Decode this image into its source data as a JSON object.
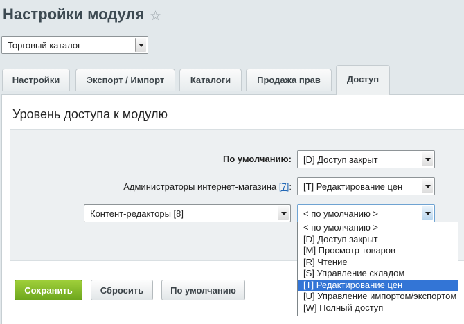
{
  "page": {
    "title": "Настройки модуля"
  },
  "module_select": {
    "value": "Торговый каталог"
  },
  "tabs": [
    {
      "label": "Настройки"
    },
    {
      "label": "Экспорт / Импорт"
    },
    {
      "label": "Каталоги"
    },
    {
      "label": "Продажа прав"
    },
    {
      "label": "Доступ"
    }
  ],
  "section": {
    "title": "Уровень доступа к модулю"
  },
  "rows": {
    "default": {
      "label": "По умолчанию:",
      "value": "[D] Доступ закрыт"
    },
    "admins": {
      "label": "Администраторы интернет-магазина ",
      "link": "[7]",
      "suffix": ":",
      "value": "[T] Редактирование цен"
    },
    "group": {
      "value": "Контент-редакторы [8]",
      "access_value": "< по умолчанию >"
    }
  },
  "access_options": [
    "< по умолчанию >",
    "[D] Доступ закрыт",
    "[M] Просмотр товаров",
    "[R] Чтение",
    "[S] Управление складом",
    "[T] Редактирование цен",
    "[U] Управление импортом/экспортом",
    "[W] Полный доступ"
  ],
  "buttons": {
    "save": "Сохранить",
    "reset": "Сбросить",
    "defaults": "По умолчанию"
  },
  "colors": {
    "save_green": "#7fb82a",
    "selected_option": "#3375d6",
    "link": "#2267b5"
  }
}
